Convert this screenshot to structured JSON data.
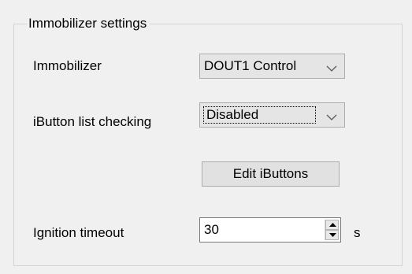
{
  "group": {
    "title": "Immobilizer settings"
  },
  "immobilizer": {
    "label": "Immobilizer",
    "value": "DOUT1 Control",
    "icon": "chevron-down-icon"
  },
  "ibutton_list": {
    "label": "iButton list checking",
    "value": "Disabled",
    "icon": "chevron-down-icon"
  },
  "edit_ibuttons": {
    "label": "Edit iButtons"
  },
  "ignition_timeout": {
    "label": "Ignition timeout",
    "value": "30",
    "unit": "s",
    "up_icon": "spin-up-icon",
    "down_icon": "spin-down-icon"
  }
}
